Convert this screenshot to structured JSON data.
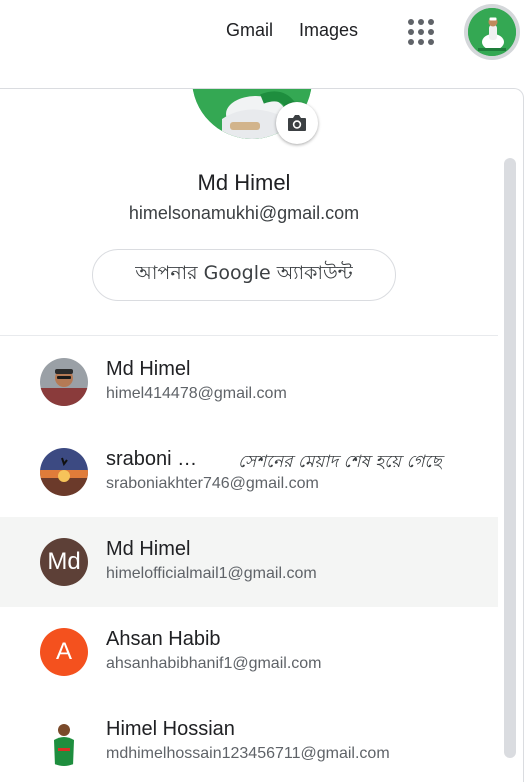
{
  "topbar": {
    "gmail_label": "Gmail",
    "images_label": "Images",
    "apps_icon": "apps-grid-icon",
    "avatar_icon": "profile-avatar"
  },
  "profile": {
    "name": "Md Himel",
    "email": "himelsonamukhi@gmail.com",
    "manage_label": "আপনার Google অ্যাকাউন্ট",
    "camera_icon": "camera-icon",
    "avatar_color": "#34a853"
  },
  "accounts": [
    {
      "name": "Md Himel",
      "email": "himel414478@gmail.com",
      "status": "",
      "avatar_letter": "",
      "avatar_color": "#8a3b3b"
    },
    {
      "name": "sraboni …",
      "email": "sraboniakhter746@gmail.com",
      "status": "সেশনের মেয়াদ শেষ হয়ে গেছে",
      "avatar_letter": "",
      "avatar_color": "#d9703a"
    },
    {
      "name": "Md Himel",
      "email": "himelofficialmail1@gmail.com",
      "status": "",
      "avatar_letter": "Md",
      "avatar_color": "#5d4037"
    },
    {
      "name": "Ahsan Habib",
      "email": "ahsanhabibhanif1@gmail.com",
      "status": "",
      "avatar_letter": "A",
      "avatar_color": "#f4511e"
    },
    {
      "name": "Himel Hossian",
      "email": "mdhimelhossain123456711@gmail.com",
      "status": "",
      "avatar_letter": "",
      "avatar_color": "#ffffff"
    }
  ]
}
